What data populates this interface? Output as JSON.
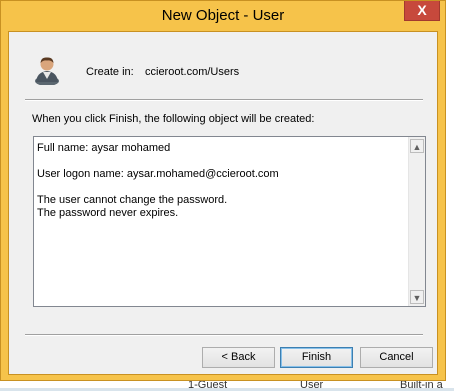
{
  "window": {
    "title": "New Object - User",
    "close_glyph": "X"
  },
  "header": {
    "icon": "user-icon",
    "create_in_label": "Create in:",
    "create_in_path": "ccieroot.com/Users"
  },
  "intro_text": "When you click Finish, the following object will be created:",
  "summary": {
    "full_name": "Full name: aysar mohamed",
    "logon_name": "User logon name: aysar.mohamed@ccieroot.com",
    "line_password_change": "The user cannot change the password.",
    "line_password_expiry": "The password never expires."
  },
  "scrollbar": {
    "up_glyph": "▲",
    "down_glyph": "▼"
  },
  "buttons": {
    "back": "< Back",
    "finish": "Finish",
    "cancel": "Cancel"
  },
  "background": {
    "item_text_1": "1-Guest",
    "item_text_2": "User",
    "item_text_3": "Built-in a"
  },
  "colors": {
    "frame": "#f6c34a",
    "close_button": "#c7493c",
    "default_button_border": "#3c7fb1"
  }
}
